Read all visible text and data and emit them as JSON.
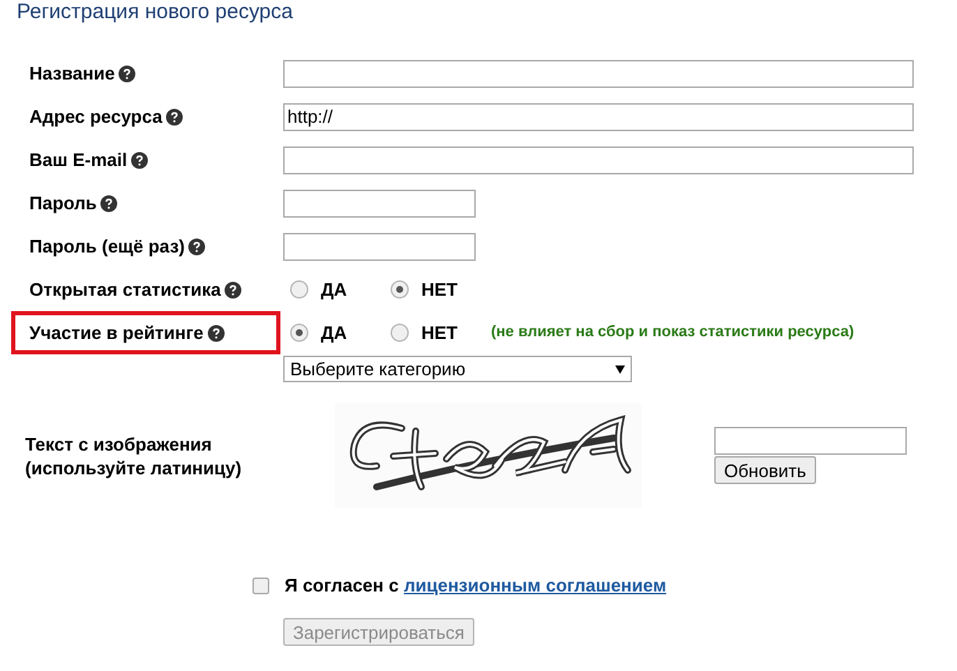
{
  "title": "Регистрация нового ресурса",
  "fields": [
    {
      "kind": "text",
      "label": "Название"
    },
    {
      "kind": "text",
      "label": "Адрес ресурса",
      "value": "http://"
    },
    {
      "kind": "text",
      "label": "Ваш E-mail"
    },
    {
      "kind": "short_text",
      "label": "Пароль"
    },
    {
      "kind": "short_text",
      "label": "Пароль (ещё раз)"
    },
    {
      "kind": "radio",
      "label": "Открытая статистика",
      "options": [
        {
          "label": "ДА",
          "selected": false
        },
        {
          "label": "НЕТ",
          "selected": true
        }
      ]
    },
    {
      "kind": "radio",
      "label": "Участие в рейтинге",
      "highlighted": true,
      "options": [
        {
          "label": "ДА",
          "selected": true
        },
        {
          "label": "НЕТ",
          "selected": false
        }
      ],
      "note": "(не влияет на сбор и показ статистики ресурса)"
    },
    {
      "kind": "select",
      "value": "Выберите категорию"
    }
  ],
  "captcha": {
    "label": "Текст с изображения (используйте латиницу)",
    "refresh_button": "Обновить"
  },
  "agreement": {
    "checked": false,
    "text": "Я согласен с",
    "link": "лицензионным соглашением"
  },
  "submit": {
    "label": "Зарегистрироваться",
    "disabled": true
  }
}
